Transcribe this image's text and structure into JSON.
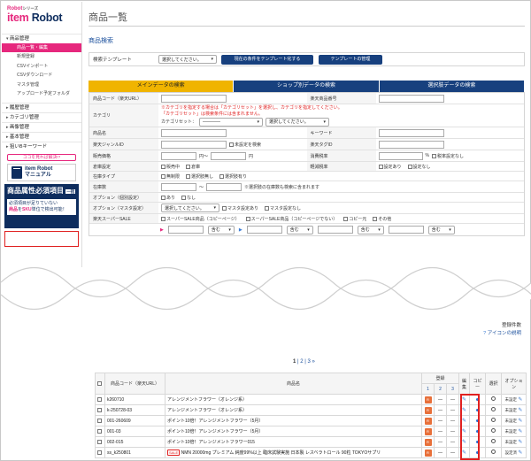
{
  "logo": {
    "series": "Robot",
    "series_suffix": "シリーズ",
    "name_a": "item",
    "name_b": "Robot"
  },
  "sidebar": {
    "sections": [
      {
        "label": "商品管理",
        "open": true
      },
      {
        "label": "履歴管理",
        "open": false
      },
      {
        "label": "カテゴリ管理",
        "open": false
      },
      {
        "label": "画像管理",
        "open": false
      },
      {
        "label": "基本管理",
        "open": false
      },
      {
        "label": "狙いBキーワード",
        "open": false
      }
    ],
    "active_item": "商品一覧・編集",
    "sub_items": [
      "新規登録",
      "CSVインポート",
      "CSVダウンロード",
      "マスタ管理",
      "アップロード予定フォルダ"
    ],
    "manual_button": "ココを見れば解決!?",
    "manual_title_1": "item Robot",
    "manual_title_2": "マニュアル",
    "banner_title": "商品属性必須項目",
    "banner_badge": "一括",
    "banner_text_1": "必須項目が足りていない",
    "banner_text_2a": "商品",
    "banner_text_2b": "を",
    "banner_text_2c": "SKU",
    "banner_text_2d": "単位で検出可能！"
  },
  "page": {
    "title": "商品一覧",
    "search_title": "商品検索",
    "template_label": "検索テンプレート",
    "template_select": "選択してください。",
    "btn_save_template": "現在の条件をテンプレート化する",
    "btn_manage_template": "テンプレートの管理"
  },
  "tabs": [
    "メインデータの検索",
    "ショップ別データの検索",
    "選択肢データの検索"
  ],
  "form": {
    "product_code": "商品コード（楽天URL）",
    "rakuten_no": "楽天商品番号",
    "category": "カテゴリ",
    "cat_note_1": "※カテゴリを指定する場合は「カテゴリセット」を選択し、カテゴリを指定してください。",
    "cat_note_2": "「カテゴリセット」は検索条件には含まれません。",
    "cat_set_label": "カテゴリセット：",
    "cat_set_value": "――――",
    "cat_select": "選択してください。",
    "product_name": "商品名",
    "keyword": "キーワード",
    "genre_id": "楽天ジャンルID",
    "genre_unset": "未設定を検索",
    "tag_id": "楽天タグID",
    "price": "販売価格",
    "yen": "円～",
    "yen_end": "円",
    "tax_rate": "消費税率",
    "percent": "%",
    "tax_unset": "税率設定なし",
    "warehouse": "倉庫設定",
    "sales": "販売中",
    "in_warehouse": "倉庫",
    "reduced_tax": "軽減税率",
    "setting_on": "設定あり",
    "setting_off": "設定なし",
    "stock_type": "在庫タイプ",
    "stock_none": "在庫タイプ",
    "stock_opt1": "無制限",
    "stock_opt2": "選択肢無し",
    "stock_opt3": "選択肢有り",
    "stock_qty": "在庫数",
    "stock_tilde": "～",
    "stock_note": "※選択肢の在庫数も検索に含まれます",
    "option_individual": "オプション（個別設定）",
    "opt_yes": "あり",
    "opt_no": "なし",
    "option_master": "オプション（マスタ設定）",
    "opt_select": "選択してください。",
    "master_on": "マスタ設定あり",
    "master_off": "マスタ設定なし",
    "super_sale": "楽天スーパーSALE",
    "ss_1": "スーパーSALE商品（コピーページ）",
    "ss_2": "スーパーSALE商品（コピーページでない）",
    "ss_3": "コピー元",
    "ss_4": "その他",
    "include": "含む"
  },
  "bottom": {
    "registered": "登録件数",
    "icon_help": "アイコンの説明",
    "pages": [
      "1",
      "2",
      "3",
      "»"
    ]
  },
  "table": {
    "headers": {
      "code": "商品コード（楽天URL）",
      "name": "商品名",
      "register": "登録",
      "edit": "編集",
      "copy": "コピー",
      "select": "選択",
      "option": "オプション",
      "r1": "1",
      "r2": "2",
      "r3": "3"
    },
    "rows": [
      {
        "code": "k260710",
        "name": "アレンジメントフラワー（オレンジ系）",
        "option": "未設定"
      },
      {
        "code": "k-250728-03",
        "name": "アレンジメントフラワー（オレンジ系）",
        "option": "未設定"
      },
      {
        "code": "001-260609",
        "name": "ポイント10倍！アレンジメントフラワー（5月）",
        "option": "未設定"
      },
      {
        "code": "001-03",
        "name": "ポイント10倍！アレンジメントフラワー（5月）",
        "option": "未設定"
      },
      {
        "code": "002-015",
        "name": "ポイント10倍！アレンジメントフラワー015",
        "option": "未設定"
      },
      {
        "code": "ss_k250801",
        "sale": "SALE",
        "name": "NMN 20000mg プレミアム 純度99%以上 臨床試験実施 日本製 レスベラトロール 90粒 TOKYOサプリ",
        "option": "設定済"
      }
    ],
    "dash": "―"
  }
}
